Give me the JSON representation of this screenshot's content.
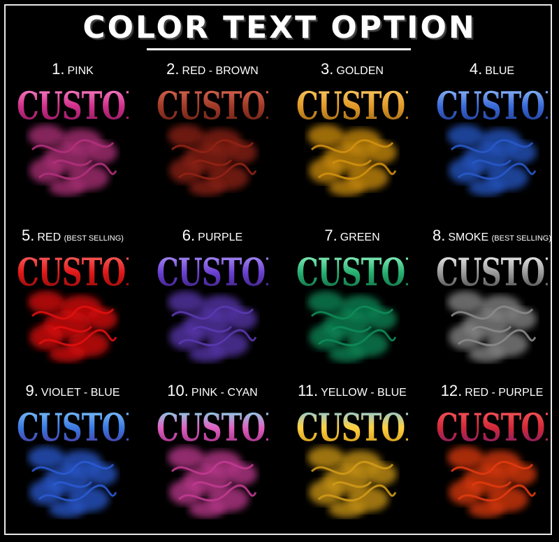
{
  "header": {
    "title": "COLOR TEXT OPTION"
  },
  "options": [
    {
      "number": "1.",
      "name": "PINK",
      "note": "",
      "word": "CUSTOM",
      "grad": [
        "#ff8fd0",
        "#d0308a",
        "#7a1050"
      ],
      "smoke": "#b0307a"
    },
    {
      "number": "2.",
      "name": "RED - BROWN",
      "note": "",
      "word": "CUSTOM",
      "grad": [
        "#e0705a",
        "#a03a28",
        "#5a1a10"
      ],
      "smoke": "#902214"
    },
    {
      "number": "3.",
      "name": "GOLDEN",
      "note": "",
      "word": "CUSTOM",
      "grad": [
        "#ffd070",
        "#e09a28",
        "#8a5a10"
      ],
      "smoke": "#d09010"
    },
    {
      "number": "4.",
      "name": "BLUE",
      "note": "",
      "word": "CUSTOM",
      "grad": [
        "#a0c8ff",
        "#3a6ad8",
        "#1a2e80"
      ],
      "smoke": "#2858c8"
    },
    {
      "number": "5.",
      "name": "RED",
      "note": "(BEST SELLING)",
      "word": "CUSTOM",
      "grad": [
        "#ff7070",
        "#e01818",
        "#780808"
      ],
      "smoke": "#e01010"
    },
    {
      "number": "6.",
      "name": "PURPLE",
      "note": "",
      "word": "CUSTOM",
      "grad": [
        "#b8a0ff",
        "#6a40d0",
        "#30186a"
      ],
      "smoke": "#5a38b0"
    },
    {
      "number": "7.",
      "name": "GREEN",
      "note": "",
      "word": "CUSTOM",
      "grad": [
        "#a0ffd0",
        "#28b070",
        "#0a5a38"
      ],
      "smoke": "#108a58"
    },
    {
      "number": "8.",
      "name": "SMOKE",
      "note": "(BEST SELLING)",
      "word": "CUSTOM",
      "grad": [
        "#ffffff",
        "#9a9a9a",
        "#3a3a3a"
      ],
      "smoke": "#8a8a8a"
    },
    {
      "number": "9.",
      "name": "VIOLET - BLUE",
      "note": "",
      "word": "CUSTOM",
      "grad": [
        "#8ad0ff",
        "#3a78e0",
        "#4a2a90"
      ],
      "smoke": "#2a5ad0"
    },
    {
      "number": "10.",
      "name": "PINK - CYAN",
      "note": "",
      "word": "CUSTOM",
      "grad": [
        "#70f0f0",
        "#e060c0",
        "#8a2070"
      ],
      "smoke": "#c03a90"
    },
    {
      "number": "11.",
      "name": "YELLOW - BLUE",
      "note": "",
      "word": "CUSTOM",
      "grad": [
        "#70c8ff",
        "#ffd040",
        "#c08a10"
      ],
      "smoke": "#d09a18"
    },
    {
      "number": "12.",
      "name": "RED - PURPLE",
      "note": "",
      "word": "CUSTOM",
      "grad": [
        "#ff6060",
        "#d02838",
        "#6a1a70"
      ],
      "smoke": "#e03a10"
    }
  ]
}
